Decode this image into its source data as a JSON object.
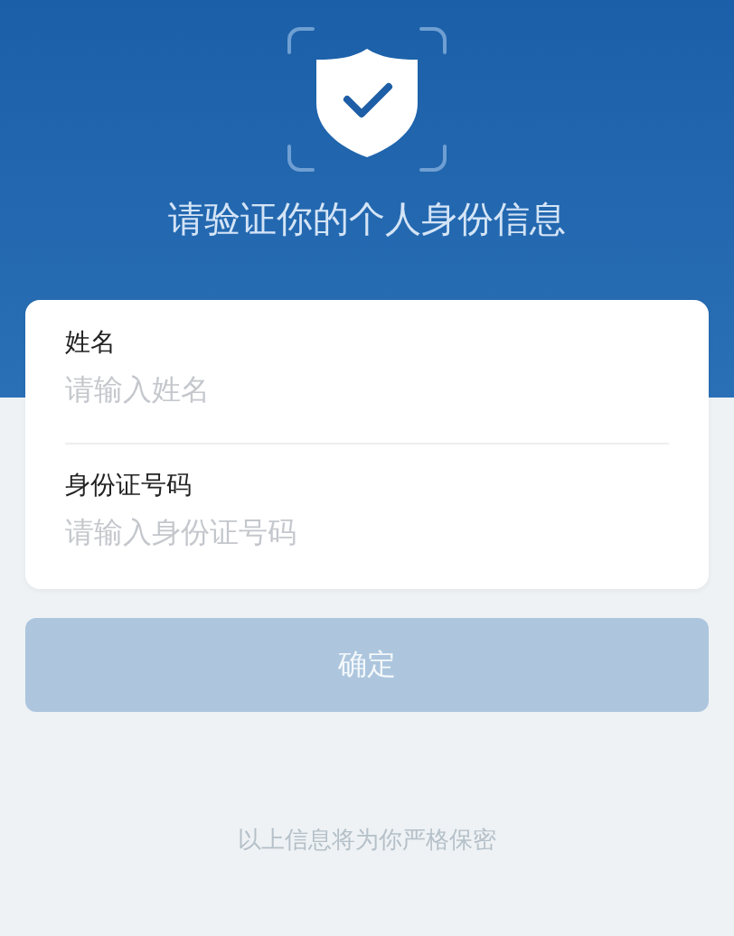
{
  "header": {
    "title": "请验证你的个人身份信息"
  },
  "form": {
    "fields": [
      {
        "label": "姓名",
        "placeholder": "请输入姓名"
      },
      {
        "label": "身份证号码",
        "placeholder": "请输入身份证号码"
      }
    ]
  },
  "confirm_button": {
    "label": "确定",
    "disabled": true
  },
  "footer_note": "以上信息将为你严格保密"
}
